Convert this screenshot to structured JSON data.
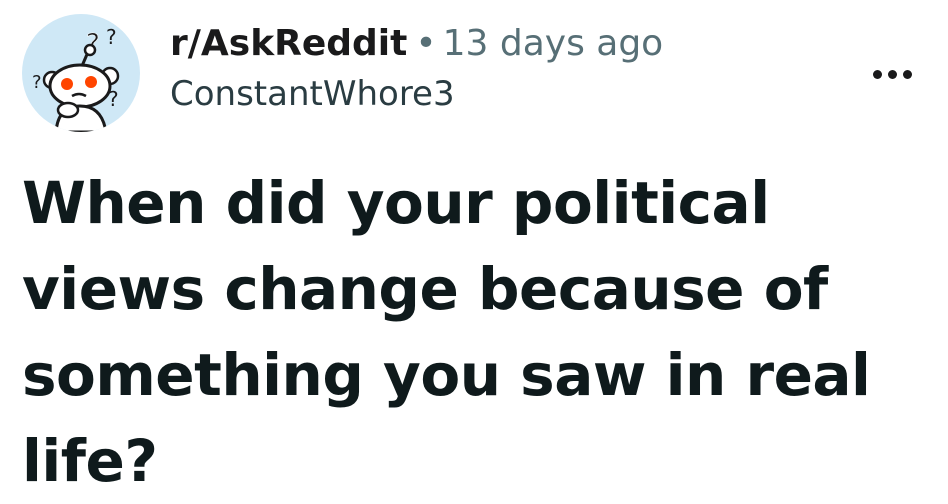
{
  "post": {
    "subreddit": "r/AskReddit",
    "separator": "•",
    "timestamp": "13 days ago",
    "author": "ConstantWhore3",
    "title": "When did your political views change because of something you saw in real life?"
  },
  "icons": {
    "avatar": "subreddit-avatar-icon",
    "more": "more-options-icon"
  },
  "colors": {
    "avatar_background": "#cfe8f6",
    "snoo_eyes": "#ff4500",
    "meta_gray": "#576f76",
    "text": "#0f1a1c"
  }
}
